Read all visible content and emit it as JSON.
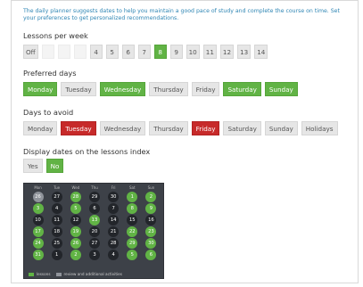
{
  "intro": "The daily planner suggests dates to help you maintain a good pace of study and complete the course on time. Set your preferences to get personalized recommendations.",
  "lessons_per_week": {
    "label": "Lessons per week",
    "options": [
      {
        "label": "Off",
        "state": "off"
      },
      {
        "label": "1",
        "state": "blank"
      },
      {
        "label": "2",
        "state": "blank"
      },
      {
        "label": "3",
        "state": "blank"
      },
      {
        "label": "4",
        "state": "off"
      },
      {
        "label": "5",
        "state": "off"
      },
      {
        "label": "6",
        "state": "off"
      },
      {
        "label": "7",
        "state": "off"
      },
      {
        "label": "8",
        "state": "on"
      },
      {
        "label": "9",
        "state": "off"
      },
      {
        "label": "10",
        "state": "off"
      },
      {
        "label": "11",
        "state": "off"
      },
      {
        "label": "12",
        "state": "off"
      },
      {
        "label": "13",
        "state": "off"
      },
      {
        "label": "14",
        "state": "off"
      }
    ]
  },
  "preferred_days": {
    "label": "Preferred days",
    "options": [
      {
        "label": "Monday",
        "state": "on"
      },
      {
        "label": "Tuesday",
        "state": "off"
      },
      {
        "label": "Wednesday",
        "state": "on"
      },
      {
        "label": "Thursday",
        "state": "off"
      },
      {
        "label": "Friday",
        "state": "off"
      },
      {
        "label": "Saturday",
        "state": "on"
      },
      {
        "label": "Sunday",
        "state": "on"
      }
    ]
  },
  "days_to_avoid": {
    "label": "Days to avoid",
    "options": [
      {
        "label": "Monday",
        "state": "off"
      },
      {
        "label": "Tuesday",
        "state": "red"
      },
      {
        "label": "Wednesday",
        "state": "off"
      },
      {
        "label": "Thursday",
        "state": "off"
      },
      {
        "label": "Friday",
        "state": "red"
      },
      {
        "label": "Saturday",
        "state": "off"
      },
      {
        "label": "Sunday",
        "state": "off"
      },
      {
        "label": "Holidays",
        "state": "off"
      }
    ]
  },
  "display_dates": {
    "label": "Display dates on the lessons index",
    "options": [
      {
        "label": "Yes",
        "state": "off"
      },
      {
        "label": "No",
        "state": "on"
      }
    ]
  },
  "calendar": {
    "weekdays": [
      "Mon",
      "Tue",
      "Wed",
      "Thu",
      "Fri",
      "Sat",
      "Sun"
    ],
    "days": [
      {
        "label": "26",
        "state": "review"
      },
      {
        "label": "27",
        "state": "dark"
      },
      {
        "label": "28",
        "state": "lesson"
      },
      {
        "label": "29",
        "state": "dark"
      },
      {
        "label": "30",
        "state": "dark"
      },
      {
        "label": "1",
        "state": "lesson"
      },
      {
        "label": "2",
        "state": "lesson"
      },
      {
        "label": "3",
        "state": "lesson"
      },
      {
        "label": "4",
        "state": "dark"
      },
      {
        "label": "5",
        "state": "lesson"
      },
      {
        "label": "6",
        "state": "dark"
      },
      {
        "label": "7",
        "state": "dark"
      },
      {
        "label": "8",
        "state": "lesson"
      },
      {
        "label": "9",
        "state": "lesson"
      },
      {
        "label": "10",
        "state": "dark"
      },
      {
        "label": "11",
        "state": "dark"
      },
      {
        "label": "12",
        "state": "dark"
      },
      {
        "label": "13",
        "state": "lesson"
      },
      {
        "label": "14",
        "state": "dark"
      },
      {
        "label": "15",
        "state": "dark"
      },
      {
        "label": "16",
        "state": "dark"
      },
      {
        "label": "17",
        "state": "lesson"
      },
      {
        "label": "18",
        "state": "dark"
      },
      {
        "label": "19",
        "state": "lesson"
      },
      {
        "label": "20",
        "state": "dark"
      },
      {
        "label": "21",
        "state": "dark"
      },
      {
        "label": "22",
        "state": "lesson"
      },
      {
        "label": "23",
        "state": "lesson"
      },
      {
        "label": "24",
        "state": "lesson"
      },
      {
        "label": "25",
        "state": "dark"
      },
      {
        "label": "26",
        "state": "lesson"
      },
      {
        "label": "27",
        "state": "dark"
      },
      {
        "label": "28",
        "state": "dark"
      },
      {
        "label": "29",
        "state": "lesson"
      },
      {
        "label": "30",
        "state": "lesson"
      },
      {
        "label": "31",
        "state": "lesson"
      },
      {
        "label": "1",
        "state": "dark"
      },
      {
        "label": "2",
        "state": "lesson"
      },
      {
        "label": "3",
        "state": "dark"
      },
      {
        "label": "4",
        "state": "dark"
      },
      {
        "label": "5",
        "state": "lesson"
      },
      {
        "label": "6",
        "state": "lesson"
      }
    ],
    "legend": {
      "lessons": "lessons",
      "review": "review and additional activities"
    }
  },
  "colors": {
    "accent_green": "#61b345",
    "avoid_red": "#c72a2a",
    "intro_blue": "#2f86b4",
    "calendar_bg": "#3d4148"
  }
}
